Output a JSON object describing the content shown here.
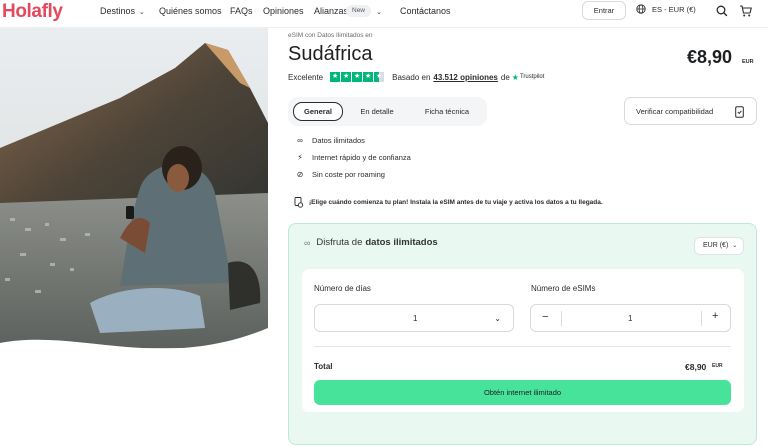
{
  "header": {
    "logo": "Holafly",
    "nav": {
      "destinos": "Destinos",
      "quienes": "Quiénes somos",
      "faqs": "FAQs",
      "opiniones": "Opiniones",
      "alianzas": "Alianzas",
      "alianzas_badge": "New",
      "contactanos": "Contáctanos"
    },
    "login_label": "Entrar",
    "locale": "ES - EUR (€)"
  },
  "product": {
    "eyebrow": "eSIM con Datos Ilimitados en",
    "country": "Sudáfrica",
    "price": "€8,90",
    "price_currency": "EUR",
    "rating_label": "Excelente",
    "rating_stars": 4.5,
    "based_on": "Basado en",
    "reviews": "43.512 opiniones",
    "reviews_of": "de",
    "trustpilot": "Trustpilot"
  },
  "tabs": [
    {
      "label": "General",
      "active": true
    },
    {
      "label": "En detalle",
      "active": false
    },
    {
      "label": "Ficha técnica",
      "active": false
    }
  ],
  "verify_button": "Verificar compatibilidad",
  "features": [
    {
      "icon": "infinity-icon",
      "label": "Datos ilimitados"
    },
    {
      "icon": "lightning-icon",
      "label": "Internet rápido y de confianza"
    },
    {
      "icon": "no-roaming-icon",
      "label": "Sin coste por roaming"
    }
  ],
  "plan_note": "¡Elige cuándo comienza tu plan! Instala la eSIM antes de tu viaje y activa los datos a tu llegada.",
  "card": {
    "title_prefix": "Disfruta de",
    "title_bold": "datos ilimitados",
    "currency_select": "EUR (€)",
    "days_label": "Número de días",
    "days_value": "1",
    "esims_label": "Número de eSIMs",
    "esims_value": "1",
    "total_label": "Total",
    "total_value": "€8,90",
    "total_currency": "EUR",
    "cta": "Obtén internet ilimitado"
  },
  "colors": {
    "brand": "#e6485c",
    "trustpilot": "#00b67a",
    "cta": "#48e39a",
    "card_bg": "#eaf8f2"
  }
}
